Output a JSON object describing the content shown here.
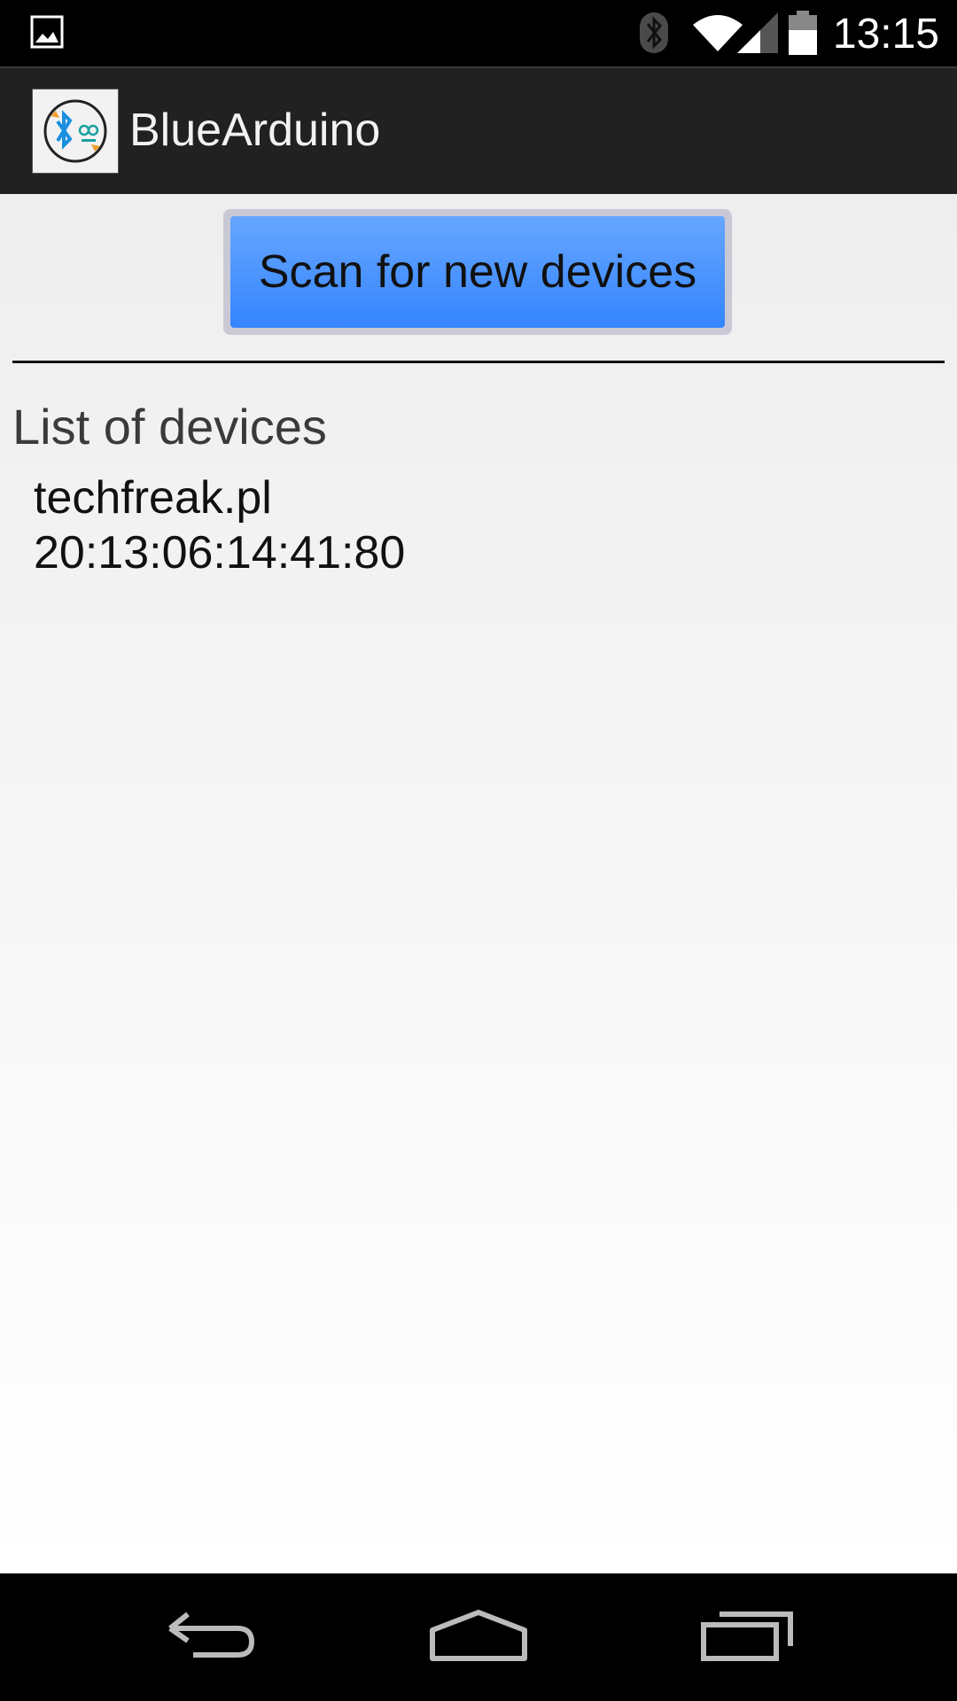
{
  "status_bar": {
    "time": "13:15",
    "icons": [
      "image-notification-icon",
      "bluetooth-icon",
      "wifi-icon",
      "signal-icon",
      "battery-icon"
    ]
  },
  "action_bar": {
    "title": "BlueArduino",
    "icon": "app-logo-icon"
  },
  "main": {
    "scan_button_label": "Scan for new devices",
    "list_heading": "List of devices",
    "devices": [
      {
        "name": "techfreak.pl",
        "address": "20:13:06:14:41:80"
      }
    ]
  },
  "nav_bar": {
    "icons": [
      "back-icon",
      "home-icon",
      "recents-icon"
    ]
  },
  "colors": {
    "status_bar": "#000000",
    "action_bar": "#212121",
    "button_top": "#66a6ff",
    "button_bottom": "#3585ff",
    "button_border": "#c9c9d6"
  }
}
